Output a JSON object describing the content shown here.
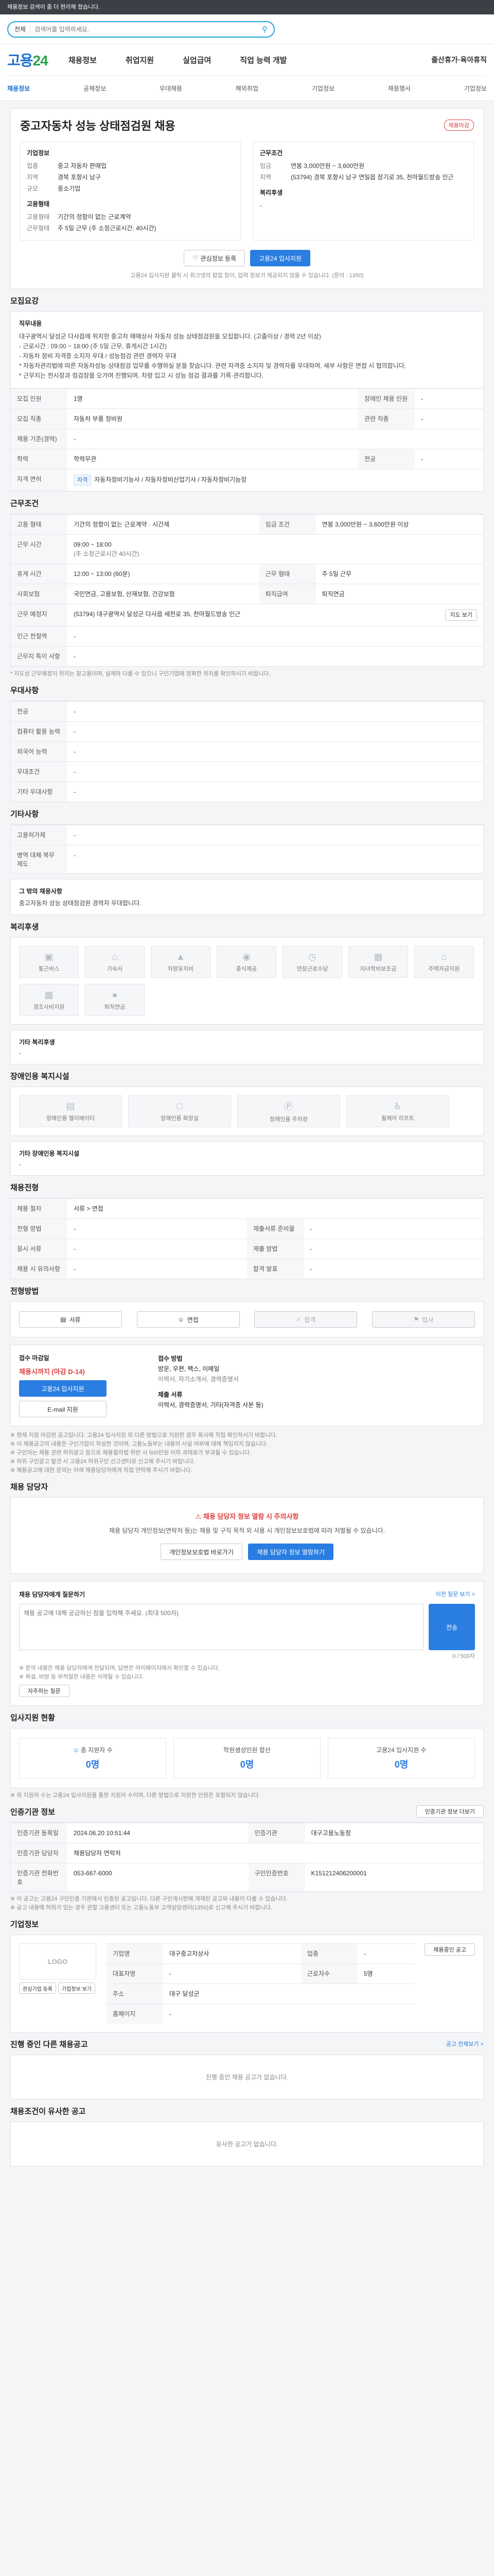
{
  "topbar": {
    "text": "채용정보 검색이 좀 더 편리해 졌습니다."
  },
  "search": {
    "scope": "전체",
    "placeholder": "검색어를 입력하세요."
  },
  "gnb": {
    "logo_main": "고용",
    "logo_num": "24",
    "menu": [
      "채용정보",
      "취업지원",
      "실업급여",
      "직업 능력 개발"
    ],
    "right": "출산휴가·육아휴직",
    "sub": [
      "채용정보",
      "공채정보",
      "우대채용",
      "해외취업",
      "기업정보",
      "채용행사",
      "기업정보"
    ]
  },
  "job": {
    "title": "중고자동차 성능 상태점검원 채용",
    "badge": "채용마감",
    "company_label": "기업정보",
    "company_rows": [
      {
        "k": "업종",
        "v": "중고 자동차 판매업"
      },
      {
        "k": "지역",
        "v": "경북 포항시 남구"
      },
      {
        "k": "규모",
        "v": "중소기업"
      }
    ],
    "cond_label": "근무조건",
    "cond_rows": [
      {
        "k": "임금",
        "v": "연봉 3,000만원 ~ 3,600만원"
      },
      {
        "k": "지역",
        "v": "(53794) 경북 포항시 남구 연일읍 장기로 35, 천마월드방송 인근"
      }
    ],
    "employ_label": "고용형태",
    "employ_rows": [
      {
        "k": "고용형태",
        "v": "기간의 정함이 없는 근로계약"
      },
      {
        "k": "근무형태",
        "v": "주 5일 근무 (주 소정근로시간: 40시간)"
      }
    ],
    "welfare_label": "복리후생",
    "welfare_v": "-",
    "save_btn": "관심정보 등록",
    "apply_btn": "고용24 입사지원",
    "notice": "고용24 입사지원 클릭 시 워크넷의 팝업 창이, 입력 정보가 제공되지 않을 수 있습니다. (문의 : 1350)"
  },
  "recruit": {
    "section": "모집요강",
    "duty_title": "직무내용",
    "duty_text": "대구광역시 달성군 다사읍에 위치한 중고차 매매상사 자동차 성능 상태점검원을 모집합니다. (고졸이상 / 경력 2년 이상)\n- 근로시간 : 09:00 ~ 18:00 (주 5일 근무, 휴게시간 1시간)\n- 자동차 정비 자격증 소지자 우대 / 성능점검 관련 경력자 우대\n* 자동차관리법에 따른 자동차성능·상태점검 업무를 수행하실 분을 찾습니다. 관련 자격증 소지자 및 경력자를 우대하며, 세부 사항은 면접 시 협의합니다.\n* 근무지는 전시장과 점검장을 오가며 진행되며, 차량 입고 시 성능 점검 결과를 기록·관리합니다.",
    "rows": [
      {
        "k": "모집 인원",
        "v": "1명",
        "k2": "장애인 채용 인원",
        "v2": "-"
      },
      {
        "k": "모집 직종",
        "v": "자동차 부품 정비원",
        "k2": "관련 직종",
        "v2": "-"
      },
      {
        "k": "채용 기준(경력)",
        "v": "-",
        "k2": "",
        "v2": ""
      },
      {
        "k": "학력",
        "v": "학력무관",
        "k2": "전공",
        "v2": "-"
      },
      {
        "k": "자격 면허",
        "v": "자동차정비기능사 / 자동차정비산업기사 / 자동차정비기능장",
        "k2": "",
        "v2": ""
      }
    ]
  },
  "workcond": {
    "section": "근무조건",
    "rows": [
      {
        "k": "고용 형태",
        "v": "기간의 정함이 없는 근로계약 · 시간제",
        "k2": "임금 조건",
        "v2": "연봉 3,000만원 ~ 3,600만원 이상"
      },
      {
        "k": "근무 시간",
        "v": "09:00 ~ 18:00",
        "k2": "",
        "v2": ""
      },
      {
        "k": "근무 시간",
        "v": "(주 소정근로시간 40시간)",
        "k2": "",
        "v2": ""
      },
      {
        "k": "휴게 시간",
        "v": "12:00 ~ 13:00 (60분)",
        "k2": "근무 형태",
        "v2": "주 5일 근무"
      },
      {
        "k": "사회보험",
        "v": "국민연금, 고용보험, 산재보험, 건강보험",
        "k2": "퇴직급여",
        "v2": "퇴직연금"
      },
      {
        "k": "근무 예정지",
        "v": "(53794) 대구광역시 달성군 다사읍 세천로 35, 천마월드방송 인근",
        "k2": "",
        "v2": ""
      },
      {
        "k": "인근 전철역",
        "v": "-",
        "k2": "",
        "v2": ""
      },
      {
        "k": "근무지 특이 사항",
        "v": "-",
        "k2": "",
        "v2": ""
      }
    ],
    "map_btn": "지도 보기",
    "note": "* 지도상 근무예정지 위치는 참고용이며, 실제와 다를 수 있으니 구인기업에 정확한 위치를 확인하시기 바랍니다."
  },
  "prefer": {
    "section": "우대사항",
    "rows": [
      {
        "k": "전공",
        "v": "-"
      },
      {
        "k": "컴퓨터 활용 능력",
        "v": "-"
      },
      {
        "k": "외국어 능력",
        "v": "-"
      },
      {
        "k": "우대조건",
        "v": "-"
      },
      {
        "k": "기타 우대사항",
        "v": "-"
      }
    ]
  },
  "other": {
    "section": "기타사항",
    "rows": [
      {
        "k": "고용허가제",
        "v": "-"
      },
      {
        "k": "병역 대체 복무 제도",
        "v": "-"
      }
    ],
    "intro_title": "그 밖의 채용사항",
    "intro_text": "중고자동차 성능 상태점검원 경력자 우대합니다."
  },
  "welfare": {
    "section": "복리후생",
    "items": [
      "통근버스",
      "기숙사",
      "차량유지비",
      "중식제공",
      "연장근로수당",
      "자녀학비보조금",
      "주택자금지원",
      "경조사비지원",
      "퇴직연금"
    ],
    "etc_label": "기타 복리후생",
    "etc_value": "-"
  },
  "disabled": {
    "section": "장애인용 복지시설",
    "items": [
      "장애인용 엘리베이터",
      "장애인용 화장실",
      "장애인용 주차장",
      "휠체어 리프트"
    ],
    "etc_label": "기타 장애인용 복지시설",
    "etc_value": "-"
  },
  "selection": {
    "section": "채용전형",
    "rows": [
      {
        "k": "채용 절차",
        "v": "서류 > 면접"
      },
      {
        "k": "전형 방법",
        "v": "-",
        "k2": "제출서류 준비물",
        "v2": "-"
      },
      {
        "k": "응시 서류",
        "v": "-",
        "k2": "제출 방법",
        "v2": "-"
      },
      {
        "k": "채용 시 유의사항",
        "v": "-",
        "k2": "합격 발표",
        "v2": "-"
      }
    ]
  },
  "process": {
    "section": "전형방법",
    "steps": [
      "서류",
      "면접",
      "합격",
      "입사"
    ]
  },
  "apply": {
    "label1": "접수 마감일",
    "deadline": "채용시까지 (마감 D-14)",
    "apply_btn": "고용24 입사지원",
    "email_btn": "E-mail 지원",
    "label2": "접수 방법",
    "methods": "방문, 우편, 팩스, 이메일",
    "method_note": "이력서, 자기소개서, 경력증명서",
    "label3": "제출 서류",
    "docs": "이력서, 경력증명서, 기타(자격증 사본 등)"
  },
  "notes": [
    "※ 현재 지원 마감된 공고입니다. 고용24 입사지원 외 다른 방법으로 지원한 경우 회사에 직접 확인하시기 바랍니다.",
    "※ 이 채용공고의 내용은 구인기업이 작성한 것이며, 고용노동부는 내용의 사실 여부에 대해 책임지지 않습니다.",
    "※ 구인자는 채용 관련 허위광고 등으로 채용절차법 위반 시 500만원 이하 과태료가 부과될 수 있습니다.",
    "※ 허위 구인광고 발견 시 고용24 허위구인 신고센터로 신고해 주시기 바랍니다.",
    "※ 채용공고에 대한 문의는 아래 채용담당자에게 직접 연락해 주시기 바랍니다."
  ],
  "contact": {
    "section": "채용 담당자",
    "alert": "채용 담당자 정보 열람 시 주의사항",
    "alert_text": "채용 담당자 개인정보(연락처 등)는 채용 및 구직 목적 외 사용 시 개인정보보호법에 따라 처벌될 수 있습니다.",
    "btn1": "개인정보보호법 바로가기",
    "btn2": "채용 담당자 정보 열람하기"
  },
  "inquiry": {
    "title": "채용 담당자에게 질문하기",
    "placeholder": "채용 공고에 대해 궁금하신 점을 입력해 주세요. (최대 500자)",
    "counter": "0 / 500자",
    "send_btn": "전송",
    "link": "이전 질문 보기 >",
    "notes": [
      "※ 문의 내용은 채용 담당자에게 전달되며, 답변은 마이페이지에서 확인할 수 있습니다.",
      "※ 욕설, 비방 등 부적절한 내용은 삭제될 수 있습니다."
    ],
    "faq_btn": "자주하는 질문"
  },
  "status": {
    "section": "입사지원 현황",
    "items": [
      {
        "label": "총 지원자 수",
        "value": "0명"
      },
      {
        "label": "학원생성인원 합산",
        "value": "0명"
      },
      {
        "label": "고용24 입사지원 수",
        "value": "0명"
      }
    ],
    "note": "※ 위 지원자 수는 고용24 입사지원을 통한 지원자 수이며, 다른 방법으로 지원한 인원은 포함되지 않습니다."
  },
  "mgmt": {
    "section": "인증기관 정보",
    "btn": "인증기관 정보 더보기",
    "rows": [
      {
        "k": "인증기관 등록일",
        "v": "2024.06.20 10:51:44",
        "k2": "인증기관",
        "v2": "대구고용노동청"
      },
      {
        "k": "인증기관 담당자",
        "v": "채용담당자 연락처",
        "k2": "",
        "v2": ""
      },
      {
        "k": "인증기관 전화번호",
        "v": "053-667-6000",
        "k2": "구인인증번호",
        "v2": "K151212406200001"
      }
    ],
    "notes": [
      "※ 이 공고는 고용24 구인인증 기관에서 인증된 공고입니다. 다른 구인게시판에 게재된 공고와 내용이 다를 수 있습니다.",
      "※ 공고 내용에 허위가 있는 경우 관할 고용센터 또는 고용노동부 고객상담센터(1350)로 신고해 주시기 바랍니다."
    ]
  },
  "company": {
    "section": "기업정보",
    "logo": "LOGO",
    "btn_fav": "관심기업 등록",
    "btn_detail": "기업정보 보기",
    "rows": [
      {
        "k": "기업명",
        "v": "대구중고차상사",
        "k2": "업종",
        "v2": "-"
      },
      {
        "k": "대표자명",
        "v": "-",
        "k2": "근로자수",
        "v2": "5명"
      },
      {
        "k": "주소",
        "v": "대구 달성군",
        "k2": "",
        "v2": ""
      },
      {
        "k": "홈페이지",
        "v": "-",
        "k2": "",
        "v2": ""
      }
    ],
    "more_btn": "채용중인 공고"
  },
  "others": {
    "section": "진행 중인 다른 채용공고",
    "link": "공고 전체보기 >",
    "empty": "진행 중인 채용 공고가 없습니다."
  },
  "similar": {
    "section": "채용조건이 유사한 공고",
    "empty": "유사한 공고가 없습니다."
  }
}
